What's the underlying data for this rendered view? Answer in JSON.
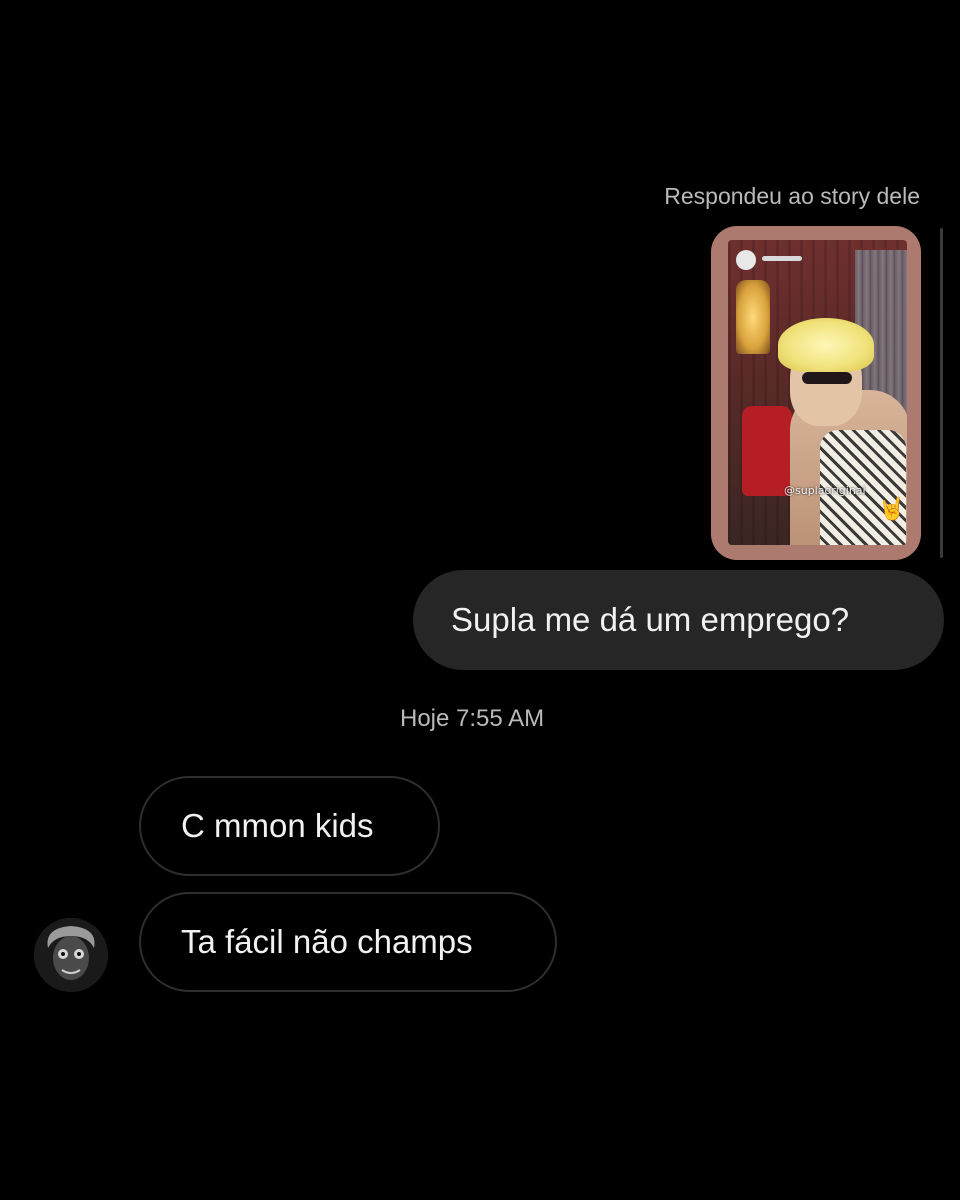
{
  "reply": {
    "label": "Respondeu ao story dele"
  },
  "story": {
    "handle": "@suplaoriginal",
    "horns_icon": "rock-horns-icon"
  },
  "messages": {
    "sent": [
      {
        "text": "Supla me dá um emprego?"
      }
    ],
    "timestamp": "Hoje 7:55 AM",
    "received": [
      {
        "text": "C mmon kids"
      },
      {
        "text": "Ta fácil não champs"
      }
    ]
  },
  "avatar": {
    "icon": "profile-avatar-icon"
  },
  "colors": {
    "background": "#000000",
    "sent_bubble": "#262626",
    "received_border": "#2e2e2e",
    "story_frame": "#ac7a6f",
    "muted_text": "#b9b9b9"
  }
}
